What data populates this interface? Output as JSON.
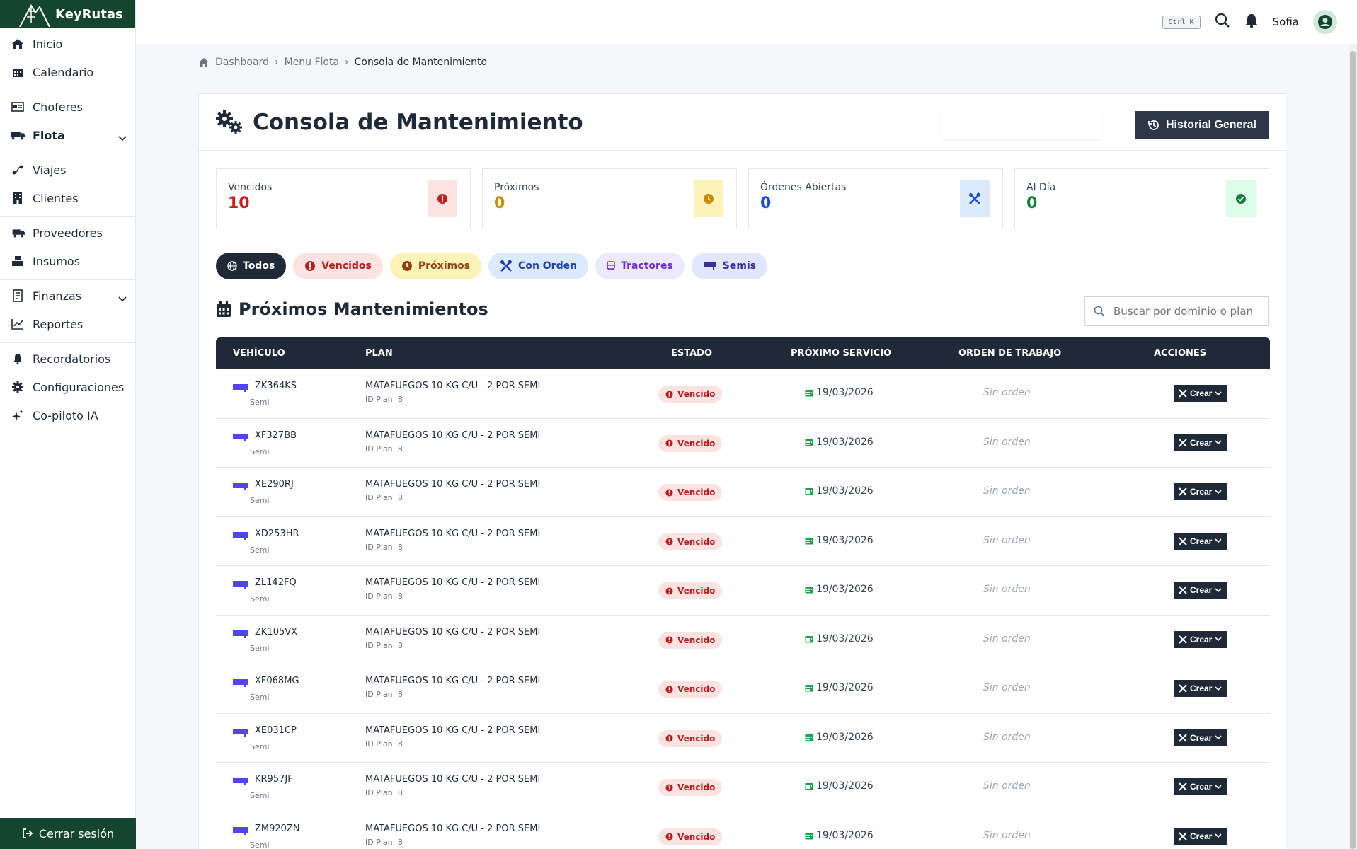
{
  "brand": {
    "name": "KeyRutas"
  },
  "sidebar": {
    "groups": [
      [
        {
          "label": "Inicio",
          "icon": "home-icon"
        },
        {
          "label": "Calendario",
          "icon": "calendar-icon"
        }
      ],
      [
        {
          "label": "Choferes",
          "icon": "id-card-icon"
        },
        {
          "label": "Flota",
          "icon": "truck-icon",
          "active": true,
          "expand": true
        }
      ],
      [
        {
          "label": "Viajes",
          "icon": "route-icon"
        },
        {
          "label": "Clientes",
          "icon": "building-icon"
        }
      ],
      [
        {
          "label": "Proveedores",
          "icon": "truck-fast-icon"
        },
        {
          "label": "Insumos",
          "icon": "boxes-icon"
        }
      ],
      [
        {
          "label": "Finanzas",
          "icon": "receipt-icon",
          "expand": true
        },
        {
          "label": "Reportes",
          "icon": "chart-line-icon"
        }
      ],
      [
        {
          "label": "Recordatorios",
          "icon": "bell-icon"
        },
        {
          "label": "Configuraciones",
          "icon": "gear-icon"
        },
        {
          "label": "Co-piloto IA",
          "icon": "sparkles-icon"
        }
      ]
    ],
    "logout_label": "Cerrar sesión"
  },
  "topbar": {
    "shortcut": "Ctrl K",
    "user_name": "Sofia"
  },
  "breadcrumb": {
    "items": [
      "Dashboard",
      "Menu Flota"
    ],
    "current": "Consola de Mantenimiento"
  },
  "header": {
    "title": "Consola de Mantenimiento",
    "history_button": "Historial General"
  },
  "stats": [
    {
      "label": "Vencidos",
      "value": "10",
      "color": "#c81e1e",
      "bg": "#fde2e2",
      "icon": "exclamation-circle-icon"
    },
    {
      "label": "Próximos",
      "value": "0",
      "color": "#c98a00",
      "bg": "#fdf3b8",
      "icon": "clock-icon"
    },
    {
      "label": "Órdenes Abiertas",
      "value": "0",
      "color": "#1d4ed8",
      "bg": "#dbeafe",
      "icon": "tools-icon"
    },
    {
      "label": "Al Día",
      "value": "0",
      "color": "#15803d",
      "bg": "#dcfce7",
      "icon": "check-circle-icon"
    }
  ],
  "filters": [
    {
      "label": "Todos",
      "bg": "#1f2937",
      "color": "#ffffff",
      "icon": "globe-icon"
    },
    {
      "label": "Vencidos",
      "bg": "#fde2e2",
      "color": "#b91c1c",
      "icon": "exclamation-circle-icon"
    },
    {
      "label": "Próximos",
      "bg": "#fdf3b8",
      "color": "#92400e",
      "icon": "clock-icon"
    },
    {
      "label": "Con Orden",
      "bg": "#dbeafe",
      "color": "#1e40af",
      "icon": "tools-icon"
    },
    {
      "label": "Tractores",
      "bg": "#ede9fe",
      "color": "#6d28d9",
      "icon": "bus-icon"
    },
    {
      "label": "Semis",
      "bg": "#e0e7ff",
      "color": "#3730a3",
      "icon": "trailer-icon"
    }
  ],
  "section": {
    "title": "Próximos Mantenimientos",
    "search_placeholder": "Buscar por dominio o plan"
  },
  "table": {
    "columns": [
      "VEHÍCULO",
      "PLAN",
      "ESTADO",
      "PRÓXIMO SERVICIO",
      "ORDEN DE TRABAJO",
      "ACCIONES"
    ],
    "rows": [
      {
        "plate": "ZK364KS",
        "type": "Semi",
        "plan": "MATAFUEGOS 10 KG C/U - 2 POR SEMI",
        "plan_id": "ID Plan: 8",
        "status": "Vencido",
        "date": "19/03/2026",
        "order": "Sin orden",
        "action": "Crear"
      },
      {
        "plate": "XF327BB",
        "type": "Semi",
        "plan": "MATAFUEGOS 10 KG C/U - 2 POR SEMI",
        "plan_id": "ID Plan: 8",
        "status": "Vencido",
        "date": "19/03/2026",
        "order": "Sin orden",
        "action": "Crear"
      },
      {
        "plate": "XE290RJ",
        "type": "Semi",
        "plan": "MATAFUEGOS 10 KG C/U - 2 POR SEMI",
        "plan_id": "ID Plan: 8",
        "status": "Vencido",
        "date": "19/03/2026",
        "order": "Sin orden",
        "action": "Crear"
      },
      {
        "plate": "XD253HR",
        "type": "Semi",
        "plan": "MATAFUEGOS 10 KG C/U - 2 POR SEMI",
        "plan_id": "ID Plan: 8",
        "status": "Vencido",
        "date": "19/03/2026",
        "order": "Sin orden",
        "action": "Crear"
      },
      {
        "plate": "ZL142FQ",
        "type": "Semi",
        "plan": "MATAFUEGOS 10 KG C/U - 2 POR SEMI",
        "plan_id": "ID Plan: 8",
        "status": "Vencido",
        "date": "19/03/2026",
        "order": "Sin orden",
        "action": "Crear"
      },
      {
        "plate": "ZK105VX",
        "type": "Semi",
        "plan": "MATAFUEGOS 10 KG C/U - 2 POR SEMI",
        "plan_id": "ID Plan: 8",
        "status": "Vencido",
        "date": "19/03/2026",
        "order": "Sin orden",
        "action": "Crear"
      },
      {
        "plate": "XF068MG",
        "type": "Semi",
        "plan": "MATAFUEGOS 10 KG C/U - 2 POR SEMI",
        "plan_id": "ID Plan: 8",
        "status": "Vencido",
        "date": "19/03/2026",
        "order": "Sin orden",
        "action": "Crear"
      },
      {
        "plate": "XE031CP",
        "type": "Semi",
        "plan": "MATAFUEGOS 10 KG C/U - 2 POR SEMI",
        "plan_id": "ID Plan: 8",
        "status": "Vencido",
        "date": "19/03/2026",
        "order": "Sin orden",
        "action": "Crear"
      },
      {
        "plate": "KR957JF",
        "type": "Semi",
        "plan": "MATAFUEGOS 10 KG C/U - 2 POR SEMI",
        "plan_id": "ID Plan: 8",
        "status": "Vencido",
        "date": "19/03/2026",
        "order": "Sin orden",
        "action": "Crear"
      },
      {
        "plate": "ZM920ZN",
        "type": "Semi",
        "plan": "MATAFUEGOS 10 KG C/U - 2 POR SEMI",
        "plan_id": "ID Plan: 8",
        "status": "Vencido",
        "date": "19/03/2026",
        "order": "Sin orden",
        "action": "Crear"
      }
    ]
  }
}
